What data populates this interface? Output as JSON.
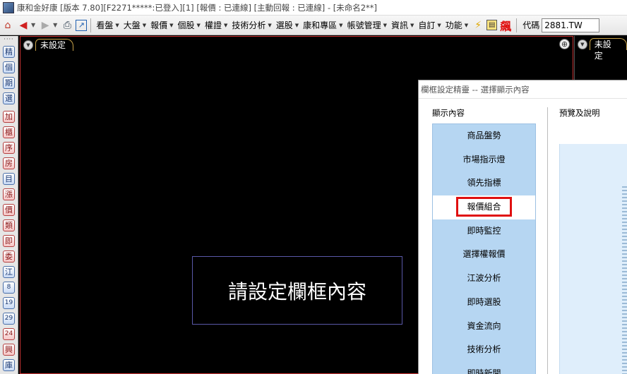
{
  "window": {
    "title": "康和金好康 [版本 7.80][F2271*****:已登入][1] [報價 : 已連線] [主動回報 : 已連線] - [未命名2**]"
  },
  "menubar": {
    "items": [
      {
        "label": "看盤"
      },
      {
        "label": "大盤"
      },
      {
        "label": "報價"
      },
      {
        "label": "個股"
      },
      {
        "label": "權證"
      },
      {
        "label": "技術分析"
      },
      {
        "label": "選股"
      },
      {
        "label": "康和專區"
      },
      {
        "label": "帳號管理"
      },
      {
        "label": "資訊"
      },
      {
        "label": "自訂"
      },
      {
        "label": "功能"
      }
    ],
    "code_label": "代碼",
    "code_value": "2881.TW"
  },
  "leftbar": {
    "buttons": [
      "精",
      "個",
      "期",
      "選",
      "加",
      "櫃",
      "序",
      "房",
      "目",
      "漲",
      "價",
      "類",
      "即",
      "委",
      "江",
      "8",
      "19",
      "29",
      "24",
      "興",
      "庫"
    ]
  },
  "panel": {
    "tab_label": "未設定",
    "message": "請設定欄框內容"
  },
  "panel2": {
    "tab_label": "未設定"
  },
  "dialog": {
    "title": "欄框設定精靈 -- 選擇顯示內容",
    "left_label": "顯示內容",
    "right_label": "預覽及說明",
    "items": [
      "商品盤勢",
      "市場指示燈",
      "領先指標",
      "報價組合",
      "即時監控",
      "選擇權報價",
      "江波分析",
      "即時選股",
      "資金流向",
      "技術分析",
      "即時新聞"
    ],
    "selected_index": 3
  },
  "colors": {
    "list_bg": "#b6d6f2",
    "highlight_border": "#e01010",
    "panel_border": "#cc3333"
  }
}
